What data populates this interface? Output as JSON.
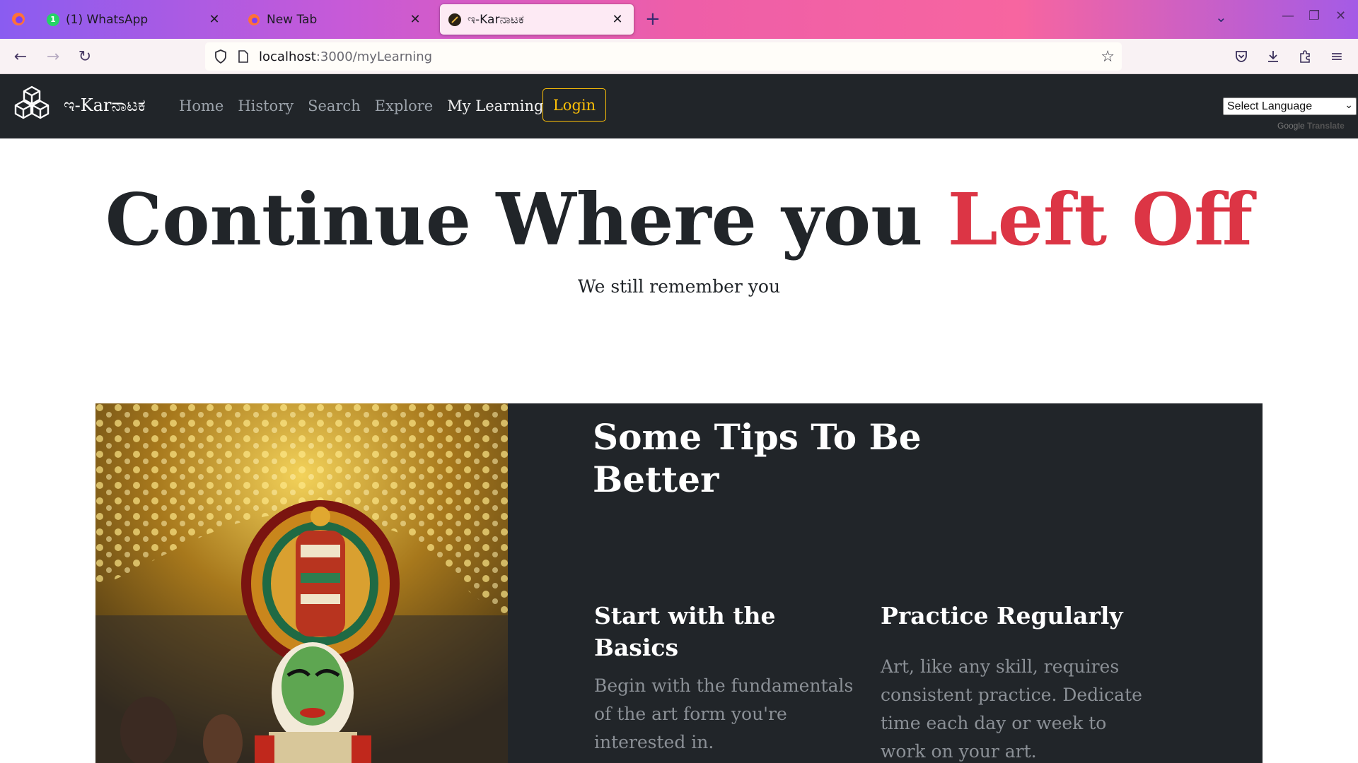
{
  "browser": {
    "tabs": [
      {
        "title": "(1) WhatsApp",
        "badge": "1",
        "active": false
      },
      {
        "title": "New Tab",
        "active": false
      },
      {
        "title": "ಇ-Karನಾಟಕ",
        "active": true
      }
    ],
    "url_host": "localhost",
    "url_path": ":3000/myLearning"
  },
  "site": {
    "brand": "ಇ-Karನಾಟಕ",
    "nav": {
      "home": "Home",
      "history": "History",
      "search": "Search",
      "explore": "Explore",
      "my_learning": "My Learning"
    },
    "login": "Login",
    "language_select": "Select Language",
    "translate_google": "Google",
    "translate_label": "Translate"
  },
  "hero": {
    "title_main": "Continue Where you ",
    "title_accent": "Left Off",
    "subtitle": "We still remember you"
  },
  "tips": {
    "title": "Some Tips To Be Better",
    "items": [
      {
        "heading": "Start with the Basics",
        "body": "Begin with the fundamentals of the art form you're interested in."
      },
      {
        "heading": "Practice Regularly",
        "body": "Art, like any skill, requires consistent practice. Dedicate time each day or week to work on your art."
      }
    ]
  },
  "colors": {
    "accent_red": "#dc3545",
    "login_yellow": "#ffc107",
    "dark_bg": "#212529"
  },
  "icons": [
    "firefox-icon",
    "back-icon",
    "forward-icon",
    "reload-icon",
    "shield-icon",
    "page-icon",
    "star-icon",
    "pocket-icon",
    "download-icon",
    "extensions-icon",
    "menu-icon",
    "cube-logo-icon"
  ]
}
